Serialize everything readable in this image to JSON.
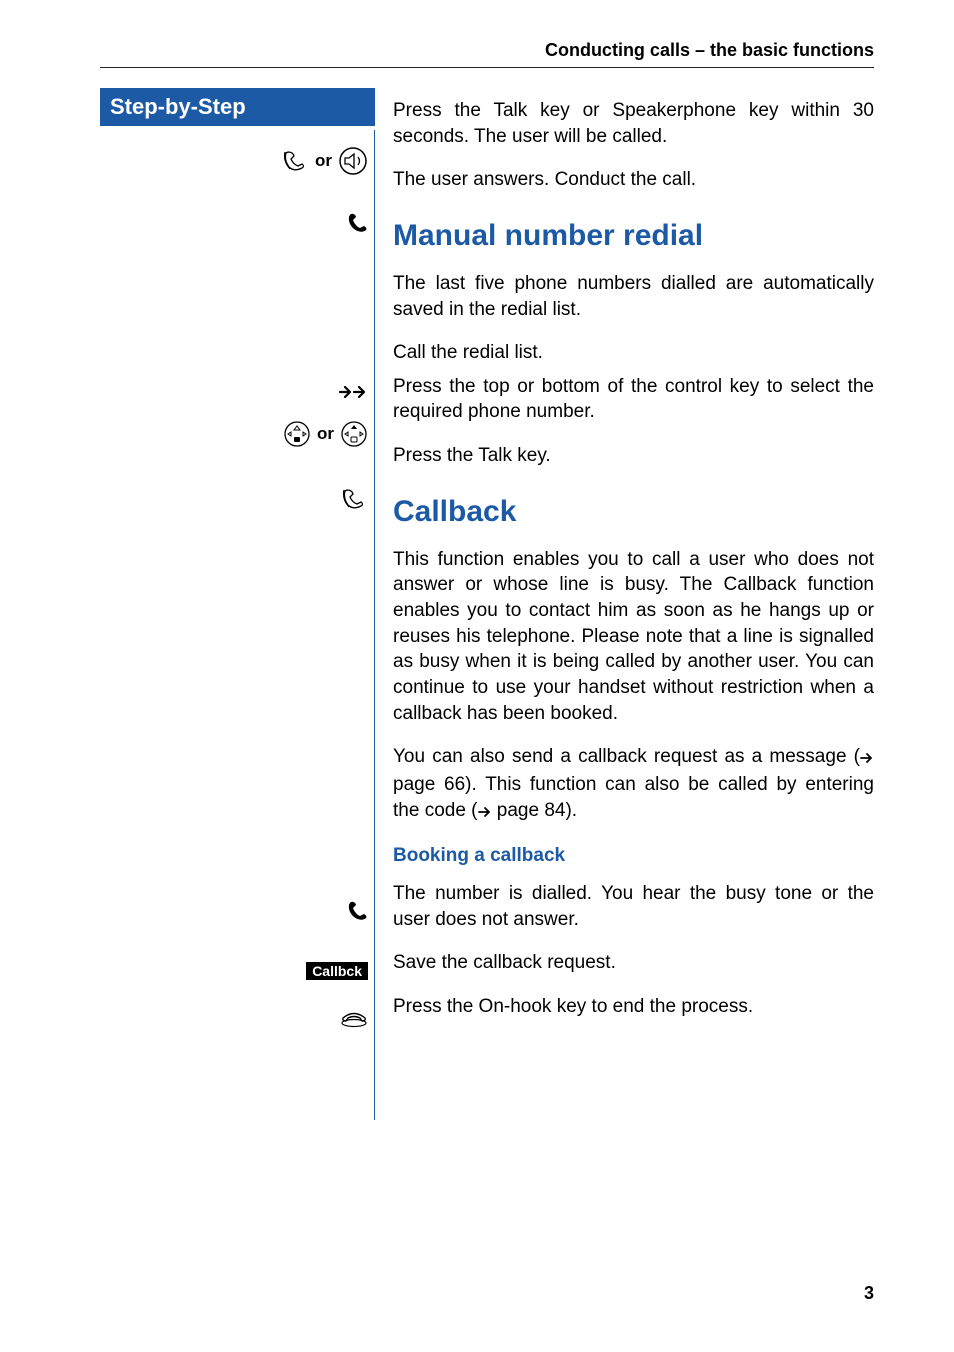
{
  "header": {
    "title": "Conducting calls – the basic functions"
  },
  "sidebar": {
    "title": "Step-by-Step",
    "or_label": "or"
  },
  "steps": {
    "s1_text": "Press the Talk key or Speakerphone key within 30 seconds. The user will be called.",
    "s2_text": "The user answers. Conduct the call."
  },
  "manual_redial": {
    "heading": "Manual number redial",
    "intro": "The last five phone numbers dialled are automatically saved in the redial list.",
    "step_a": "Call the redial list.",
    "step_b": "Press the top or bottom of the control key to select the required phone number.",
    "step_c": "Press the Talk key."
  },
  "callback": {
    "heading": "Callback",
    "para1": "This function enables you to call a user who does not answer or whose line is busy. The Callback function enables you to contact him as soon as he hangs up or reuses his telephone. Please note that a line is signalled as busy when it is being called by another user. You can continue to use your handset without restriction when a callback has been booked.",
    "para2_a": "You can also send a callback request as a message (",
    "para2_page1": "page 66",
    "para2_b": "). This function can also be called by entering the code (",
    "para2_page2": "page 84",
    "para2_c": ").",
    "booking_heading": "Booking a callback",
    "booking_step1": "The number is dialled. You hear the busy tone or the user does not answer.",
    "booking_badge": "Callbck",
    "booking_step2": "Save the callback request.",
    "booking_step3": "Press the On-hook key to end the process."
  },
  "page_number": "3"
}
